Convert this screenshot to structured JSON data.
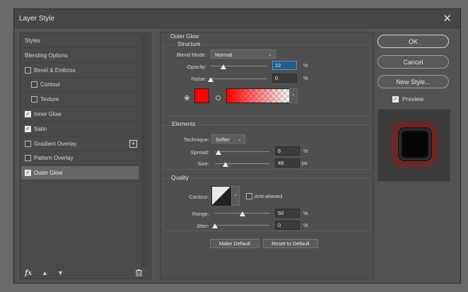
{
  "dialog": {
    "title": "Layer Style"
  },
  "styles_list": {
    "items": [
      {
        "label": "Styles",
        "checkbox": false,
        "checked": false,
        "indent": 0,
        "selected": false
      },
      {
        "label": "Blending Options",
        "checkbox": false,
        "checked": false,
        "indent": 0,
        "selected": false
      },
      {
        "label": "Bevel & Emboss",
        "checkbox": true,
        "checked": false,
        "indent": 0,
        "selected": false
      },
      {
        "label": "Contour",
        "checkbox": true,
        "checked": false,
        "indent": 1,
        "selected": false
      },
      {
        "label": "Texture",
        "checkbox": true,
        "checked": false,
        "indent": 1,
        "selected": false
      },
      {
        "label": "Inner Glow",
        "checkbox": true,
        "checked": true,
        "indent": 0,
        "selected": false
      },
      {
        "label": "Satin",
        "checkbox": true,
        "checked": true,
        "indent": 0,
        "selected": false
      },
      {
        "label": "Gradient Overlay",
        "checkbox": true,
        "checked": false,
        "indent": 0,
        "selected": false,
        "add": true
      },
      {
        "label": "Pattern Overlay",
        "checkbox": true,
        "checked": false,
        "indent": 0,
        "selected": false
      },
      {
        "label": "Outer Glow",
        "checkbox": true,
        "checked": true,
        "indent": 0,
        "selected": true
      }
    ],
    "bottom_icons": [
      "fx-icon",
      "arrow-up-icon",
      "arrow-down-icon",
      "trash-icon"
    ],
    "fx_label": "fx"
  },
  "outer_glow": {
    "section_title": "Outer Glow",
    "structure": {
      "title": "Structure",
      "blend_mode_label": "Blend Mode:",
      "blend_mode_value": "Normal",
      "opacity_label": "Opacity:",
      "opacity_value": "22",
      "opacity_level": 0.22,
      "noise_label": "Noise:",
      "noise_value": "0",
      "noise_level": 0,
      "percent": "%",
      "glow_color": "#ff0000"
    },
    "elements": {
      "title": "Elements",
      "technique_label": "Technique:",
      "technique_value": "Softer",
      "spread_label": "Spread:",
      "spread_value": "6",
      "spread_level": 0.06,
      "size_label": "Size:",
      "size_value": "48",
      "size_level": 0.19,
      "percent": "%",
      "px": "px"
    },
    "quality": {
      "title": "Quality",
      "contour_label": "Contour:",
      "anti_aliased_label": "Anti-aliased",
      "range_label": "Range:",
      "range_value": "50",
      "range_level": 0.5,
      "jitter_label": "Jitter:",
      "jitter_value": "0",
      "jitter_level": 0,
      "percent": "%"
    },
    "make_default": "Make Default",
    "reset_default": "Reset to Default"
  },
  "buttons": {
    "ok": "OK",
    "cancel": "Cancel",
    "new_style": "New Style...",
    "preview_label": "Preview",
    "preview_checked": true
  },
  "colors": {
    "accent_focus": "#285a8e",
    "glow": "#ff0000"
  }
}
